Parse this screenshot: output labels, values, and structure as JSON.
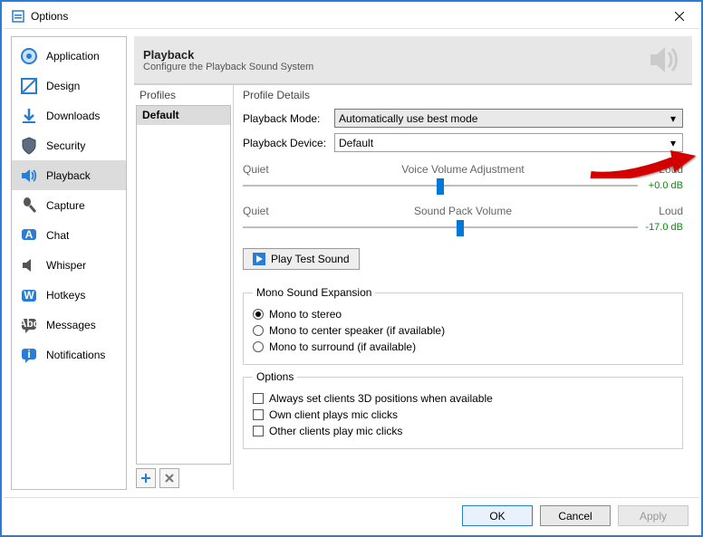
{
  "window": {
    "title": "Options"
  },
  "sidebar": {
    "items": [
      {
        "label": "Application"
      },
      {
        "label": "Design"
      },
      {
        "label": "Downloads"
      },
      {
        "label": "Security"
      },
      {
        "label": "Playback"
      },
      {
        "label": "Capture"
      },
      {
        "label": "Chat"
      },
      {
        "label": "Whisper"
      },
      {
        "label": "Hotkeys"
      },
      {
        "label": "Messages"
      },
      {
        "label": "Notifications"
      }
    ]
  },
  "header": {
    "title": "Playback",
    "subtitle": "Configure the Playback Sound System"
  },
  "profiles": {
    "heading": "Profiles",
    "items": [
      "Default"
    ]
  },
  "details": {
    "heading": "Profile Details",
    "mode_label": "Playback Mode:",
    "mode_value": "Automatically use best mode",
    "device_label": "Playback Device:",
    "device_value": "Default",
    "slider1": {
      "left": "Quiet",
      "center": "Voice Volume Adjustment",
      "right": "Loud",
      "value_text": "+0.0 dB",
      "pos": 0.5
    },
    "slider2": {
      "left": "Quiet",
      "center": "Sound Pack Volume",
      "right": "Loud",
      "value_text": "-17.0 dB",
      "pos": 0.55
    },
    "play_test": "Play Test Sound",
    "mono": {
      "legend": "Mono Sound Expansion",
      "opt1": "Mono to stereo",
      "opt2": "Mono to center speaker (if available)",
      "opt3": "Mono to surround (if available)"
    },
    "options": {
      "legend": "Options",
      "opt1": "Always set clients 3D positions when available",
      "opt2": "Own client plays mic clicks",
      "opt3": "Other clients play mic clicks"
    }
  },
  "footer": {
    "ok": "OK",
    "cancel": "Cancel",
    "apply": "Apply"
  }
}
